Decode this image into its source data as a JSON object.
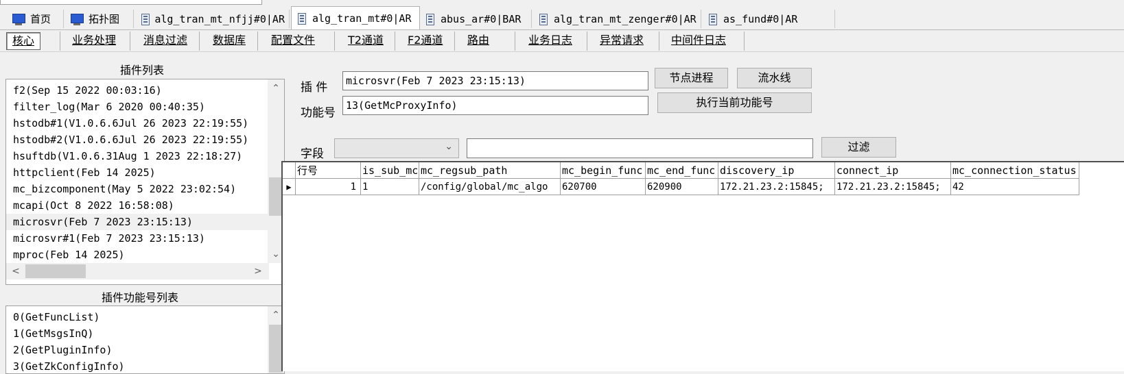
{
  "tabs": [
    {
      "label": "首页",
      "icon": "computer-icon"
    },
    {
      "label": "拓扑图",
      "icon": "computer-icon"
    },
    {
      "label": "alg_tran_mt_nfjj#0|AR",
      "icon": "database-icon"
    },
    {
      "label": "alg_tran_mt#0|AR",
      "icon": "database-icon",
      "active": true
    },
    {
      "label": "abus_ar#0|BAR",
      "icon": "database-icon"
    },
    {
      "label": "alg_tran_mt_zenger#0|AR",
      "icon": "database-icon"
    },
    {
      "label": "as_fund#0|AR",
      "icon": "database-icon"
    }
  ],
  "menus": [
    "核心",
    "业务处理",
    "消息过滤",
    "数据库",
    "配置文件",
    "T2通道",
    "F2通道",
    "路由",
    "业务日志",
    "异常请求",
    "中间件日志"
  ],
  "plugin_list": {
    "title": "插件列表",
    "items": [
      "f2(Sep 15 2022 00:03:16)",
      "filter_log(Mar  6 2020 00:40:35)",
      "hstodb#1(V1.0.6.6Jul 26 2023 22:19:55)",
      "hstodb#2(V1.0.6.6Jul 26 2023 22:19:55)",
      "hsuftdb(V1.0.6.31Aug  1 2023 22:18:27)",
      "httpclient(Feb 14 2025)",
      "mc_bizcomponent(May  5 2022 23:02:54)",
      "mcapi(Oct  8 2022 16:58:08)",
      "microsvr(Feb  7 2023 23:15:13)",
      "microsvr#1(Feb  7 2023 23:15:13)",
      "mproc(Feb 14 2025)"
    ],
    "selected_index": 8
  },
  "func_list": {
    "title": "插件功能号列表",
    "items": [
      "0(GetFuncList)",
      "1(GetMsgsInQ)",
      "2(GetPluginInfo)",
      "3(GetZkConfigInfo)"
    ]
  },
  "form": {
    "plugin_label": "插 件",
    "plugin_value": "microsvr(Feb  7 2023 23:15:13)",
    "func_label": "功能号",
    "func_value": "13(GetMcProxyInfo)",
    "node_process_btn": "节点进程",
    "pipeline_btn": "流水线",
    "exec_btn": "执行当前功能号",
    "field_label": "字段",
    "field_value": "",
    "filter_text": "",
    "filter_btn": "过滤"
  },
  "grid": {
    "columns": [
      "行号",
      "is_sub_mc",
      "mc_regsub_path",
      "mc_begin_func",
      "mc_end_func",
      "discovery_ip",
      "connect_ip",
      "mc_connection_status"
    ],
    "rows": [
      [
        "1",
        "1",
        "/config/global/mc_algo",
        "620700",
        "620900",
        "172.21.23.2:15845;",
        "172.21.23.2:15845;",
        "42"
      ]
    ]
  }
}
